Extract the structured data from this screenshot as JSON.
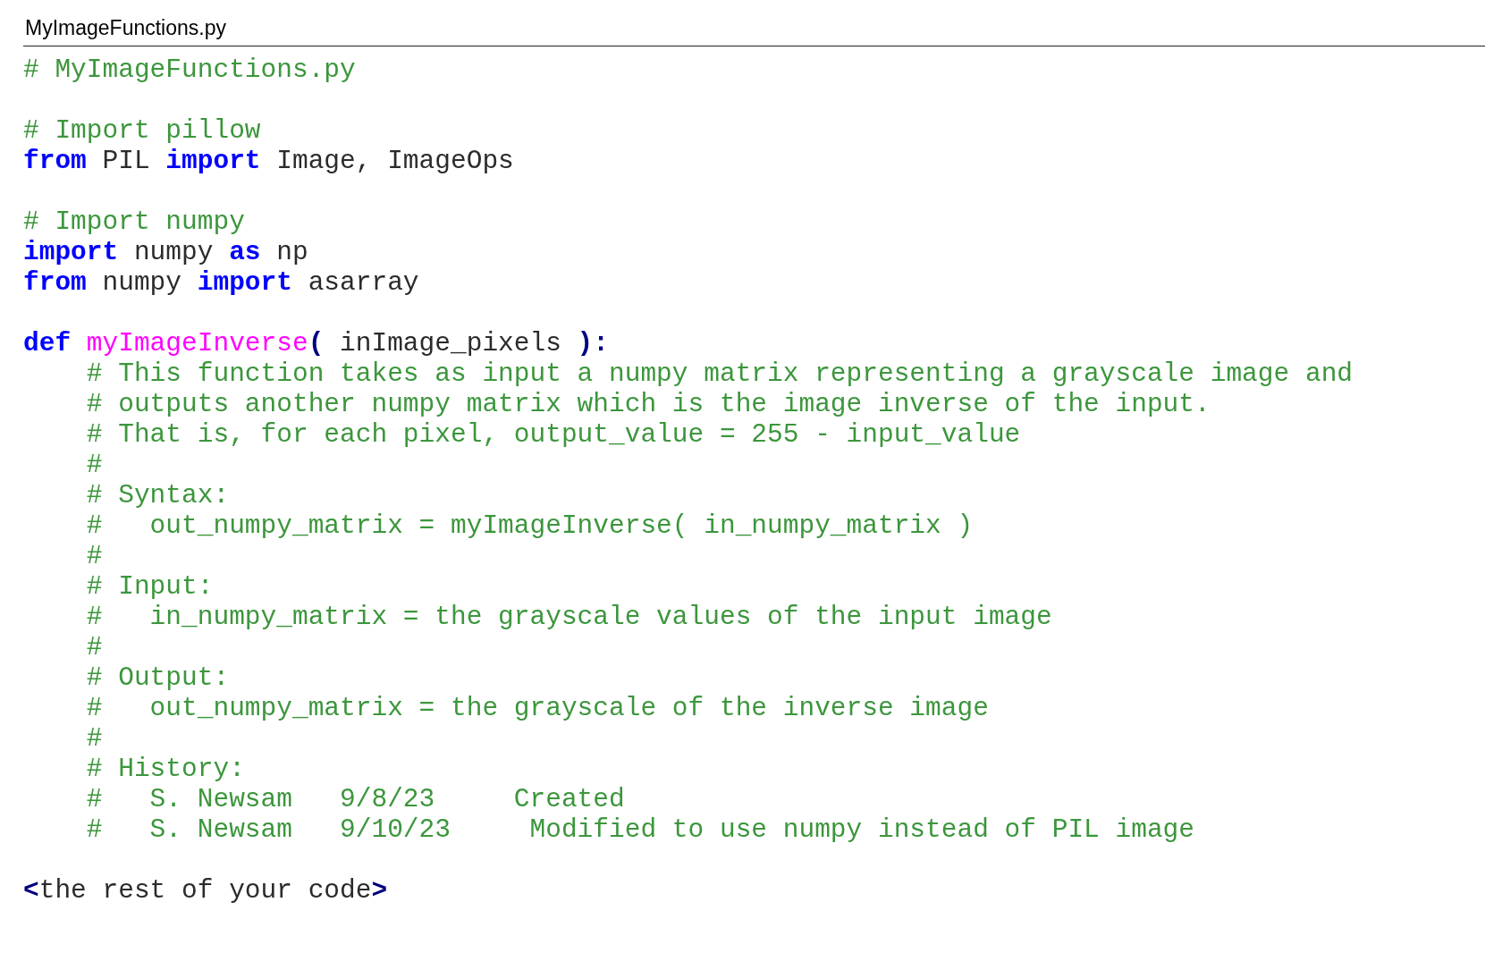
{
  "file_title": "MyImageFunctions.py",
  "lines": [
    {
      "kind": "code",
      "tokens": [
        {
          "kind": "comment",
          "text": "# MyImageFunctions.py"
        }
      ]
    },
    {
      "kind": "blank"
    },
    {
      "kind": "code",
      "tokens": [
        {
          "kind": "comment",
          "text": "# Import pillow"
        }
      ]
    },
    {
      "kind": "code",
      "tokens": [
        {
          "kind": "keyword",
          "text": "from"
        },
        {
          "kind": "plain",
          "text": " PIL "
        },
        {
          "kind": "keyword",
          "text": "import"
        },
        {
          "kind": "plain",
          "text": " Image, ImageOps"
        }
      ]
    },
    {
      "kind": "blank"
    },
    {
      "kind": "code",
      "tokens": [
        {
          "kind": "comment",
          "text": "# Import numpy"
        }
      ]
    },
    {
      "kind": "code",
      "tokens": [
        {
          "kind": "keyword",
          "text": "import"
        },
        {
          "kind": "plain",
          "text": " numpy "
        },
        {
          "kind": "keyword",
          "text": "as"
        },
        {
          "kind": "plain",
          "text": " np"
        }
      ]
    },
    {
      "kind": "code",
      "tokens": [
        {
          "kind": "keyword",
          "text": "from"
        },
        {
          "kind": "plain",
          "text": " numpy "
        },
        {
          "kind": "keyword",
          "text": "import"
        },
        {
          "kind": "plain",
          "text": " asarray"
        }
      ]
    },
    {
      "kind": "blank"
    },
    {
      "kind": "code",
      "tokens": [
        {
          "kind": "keyword",
          "text": "def "
        },
        {
          "kind": "function",
          "text": "myImageInverse"
        },
        {
          "kind": "operator",
          "text": "("
        },
        {
          "kind": "plain",
          "text": " inImage_pixels "
        },
        {
          "kind": "operator",
          "text": "):"
        }
      ]
    },
    {
      "kind": "code",
      "tokens": [
        {
          "kind": "comment",
          "text": "    # This function takes as input a numpy matrix representing a grayscale image and"
        }
      ]
    },
    {
      "kind": "code",
      "tokens": [
        {
          "kind": "comment",
          "text": "    # outputs another numpy matrix which is the image inverse of the input."
        }
      ]
    },
    {
      "kind": "code",
      "tokens": [
        {
          "kind": "comment",
          "text": "    # That is, for each pixel, output_value = 255 - input_value"
        }
      ]
    },
    {
      "kind": "code",
      "tokens": [
        {
          "kind": "comment",
          "text": "    #"
        }
      ]
    },
    {
      "kind": "code",
      "tokens": [
        {
          "kind": "comment",
          "text": "    # Syntax:"
        }
      ]
    },
    {
      "kind": "code",
      "tokens": [
        {
          "kind": "comment",
          "text": "    #   out_numpy_matrix = myImageInverse( in_numpy_matrix )"
        }
      ]
    },
    {
      "kind": "code",
      "tokens": [
        {
          "kind": "comment",
          "text": "    #"
        }
      ]
    },
    {
      "kind": "code",
      "tokens": [
        {
          "kind": "comment",
          "text": "    # Input:"
        }
      ]
    },
    {
      "kind": "code",
      "tokens": [
        {
          "kind": "comment",
          "text": "    #   in_numpy_matrix = the grayscale values of the input image"
        }
      ]
    },
    {
      "kind": "code",
      "tokens": [
        {
          "kind": "comment",
          "text": "    #"
        }
      ]
    },
    {
      "kind": "code",
      "tokens": [
        {
          "kind": "comment",
          "text": "    # Output:"
        }
      ]
    },
    {
      "kind": "code",
      "tokens": [
        {
          "kind": "comment",
          "text": "    #   out_numpy_matrix = the grayscale of the inverse image"
        }
      ]
    },
    {
      "kind": "code",
      "tokens": [
        {
          "kind": "comment",
          "text": "    #"
        }
      ]
    },
    {
      "kind": "code",
      "tokens": [
        {
          "kind": "comment",
          "text": "    # History:"
        }
      ]
    },
    {
      "kind": "code",
      "tokens": [
        {
          "kind": "comment",
          "text": "    #   S. Newsam   9/8/23     Created"
        }
      ]
    },
    {
      "kind": "code",
      "tokens": [
        {
          "kind": "comment",
          "text": "    #   S. Newsam   9/10/23     Modified to use numpy instead of PIL image"
        }
      ]
    },
    {
      "kind": "blank"
    },
    {
      "kind": "code",
      "tokens": [
        {
          "kind": "operator",
          "text": "<"
        },
        {
          "kind": "plain",
          "text": "the rest of your code"
        },
        {
          "kind": "operator",
          "text": ">"
        }
      ]
    }
  ]
}
